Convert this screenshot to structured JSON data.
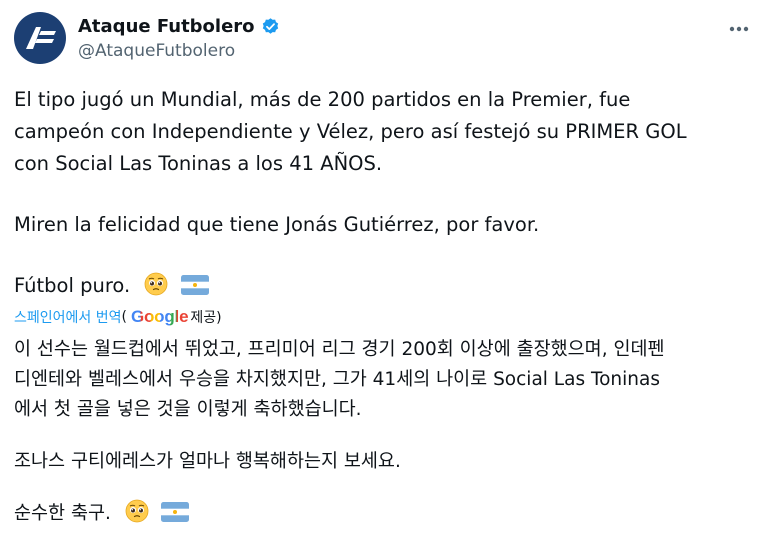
{
  "account": {
    "display_name": "Ataque Futbolero",
    "handle": "@AtaqueFutbolero",
    "avatar_icon": "ataque-futbolero-logo",
    "verified_icon": "verified-badge",
    "more_icon": "more-options-icon"
  },
  "tweet": {
    "original_lines": [
      "El tipo jugó un Mundial, más de 200 partidos en la Premier, fue",
      "campeón con Independiente y Vélez, pero así festejó su PRIMER GOL",
      "con Social Las Toninas a los 41 AÑOS.",
      "Miren la felicidad que tiene Jonás Gutiérrez, por favor.",
      "Fútbol puro."
    ],
    "translate_link": "스페인어에서 번역",
    "translate_provider_open": "(",
    "google_logo_text": "Google",
    "translate_provider_close": "제공)",
    "translated_lines": [
      "이 선수는 월드컵에서 뛰었고, 프리미어 리그 경기 200회 이상에 출장했으며, 인데펜",
      "디엔테와 벨레스에서 우승을 차지했지만, 그가 41세의 나이로 Social Las Toninas",
      "에서 첫 골을 넣은 것을 이렇게 축하했습니다.",
      "조나스 구티에레스가 얼마나 행복해하는지 보세요.",
      "순수한 축구."
    ],
    "emojis": [
      "pleading-face-emoji",
      "argentina-flag-emoji"
    ]
  },
  "colors": {
    "accent": "#1d9bf0",
    "text": "#0f1419",
    "secondary_text": "#536471",
    "avatar_bg": "#1c3f73"
  }
}
